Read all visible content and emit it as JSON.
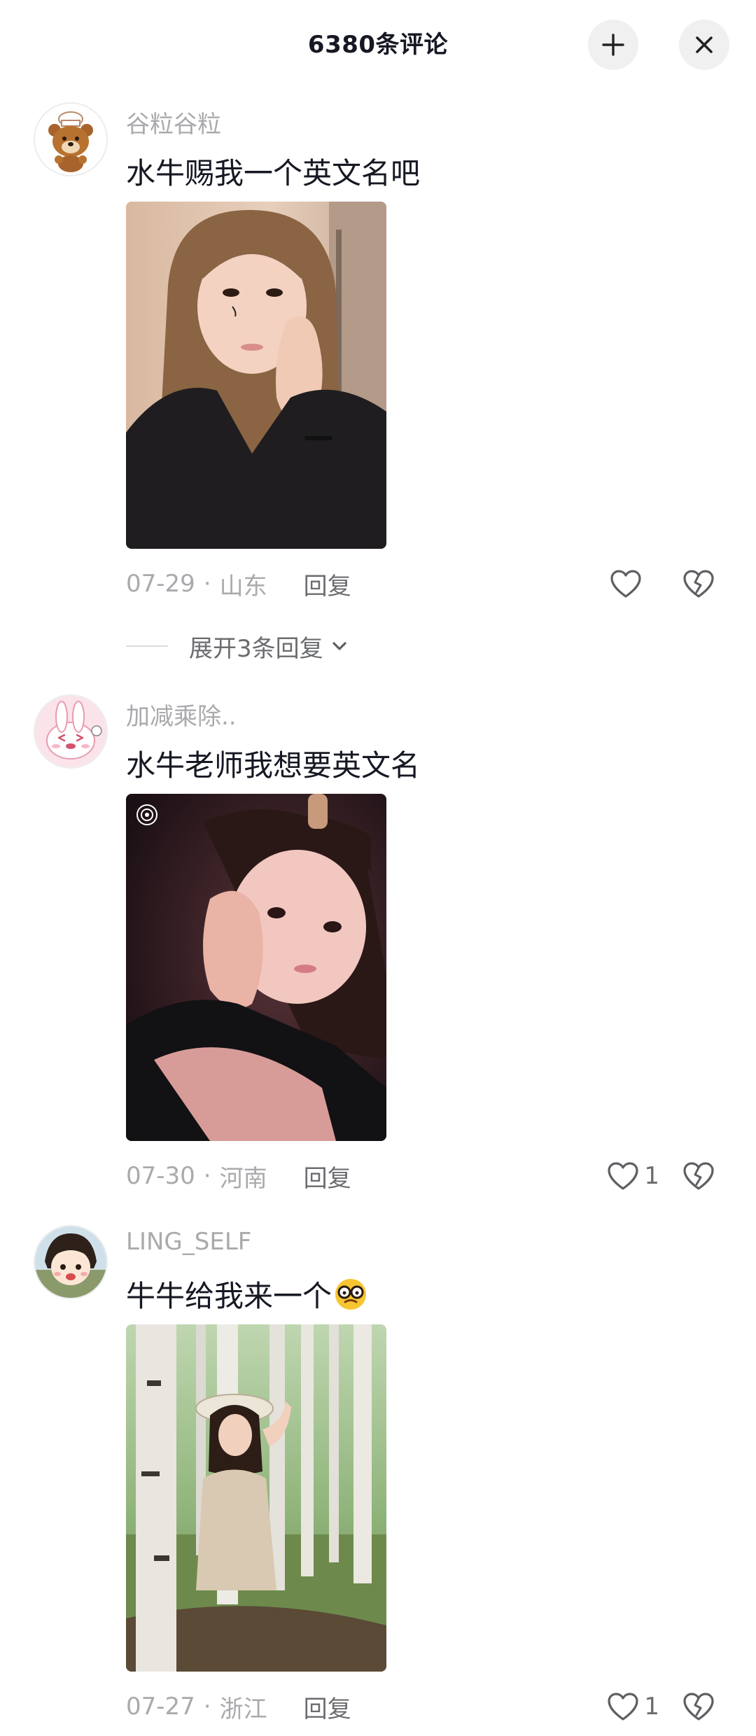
{
  "header": {
    "title": "6380条评论",
    "collapse_icon": "collapse-icon",
    "close_icon": "close-icon"
  },
  "comments": [
    {
      "username": "谷粒谷粒",
      "text": "水牛赐我一个英文名吧",
      "date": "07-29",
      "separator": "·",
      "location": "山东",
      "reply_label": "回复",
      "like_count": "",
      "expand_label": "展开3条回复",
      "avatar_icon": "bear-chef-avatar",
      "photo_desc_colors": [
        "#d8b59a",
        "#1c1c1f"
      ]
    },
    {
      "username": "加减乘除..",
      "text": "水牛老师我想要英文名",
      "date": "07-30",
      "separator": "·",
      "location": "河南",
      "reply_label": "回复",
      "like_count": "1",
      "avatar_icon": "bunny-avatar"
    },
    {
      "username": "LING_SELF",
      "text": "牛牛给我来一个",
      "date": "07-27",
      "separator": "·",
      "location": "浙江",
      "reply_label": "回复",
      "like_count": "1",
      "avatar_icon": "cartoon-girl-avatar",
      "text_emoji": "nerd-glasses-emoji"
    }
  ],
  "colors": {
    "primary_text": "#161823",
    "secondary_text": "#a9aaad",
    "action_text": "#6b6c70",
    "button_bg": "#f0f0f1"
  }
}
